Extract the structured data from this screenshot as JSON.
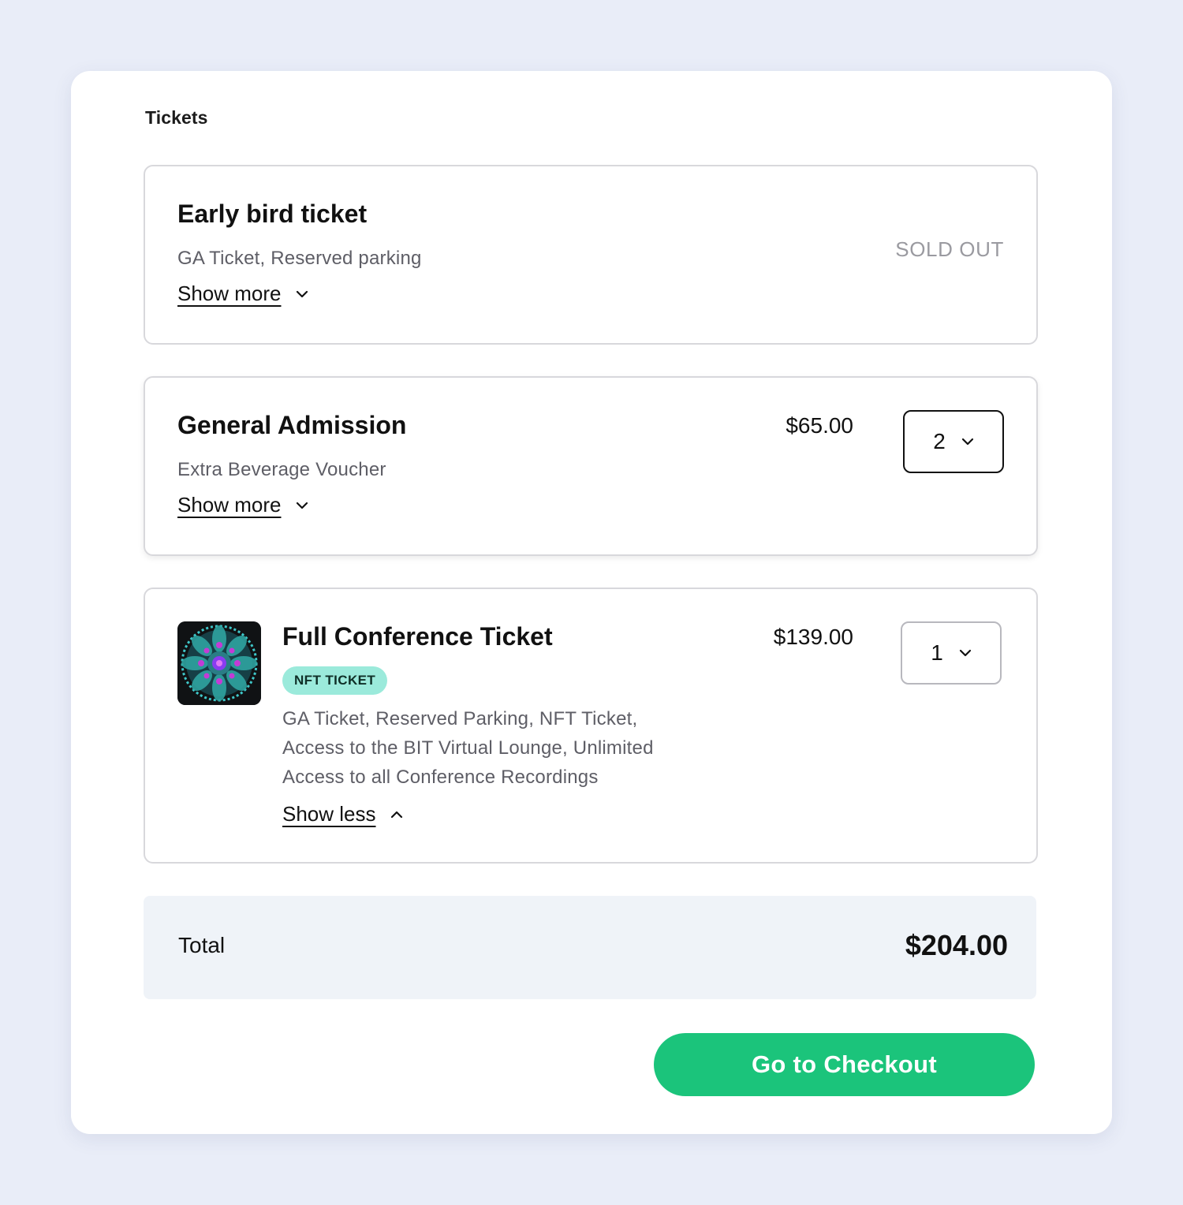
{
  "section_title": "Tickets",
  "tickets": [
    {
      "name": "Early bird ticket",
      "description": "GA Ticket, Reserved parking",
      "toggle_label": "Show more",
      "toggle_icon": "chevron-down-icon",
      "status": "SOLD OUT"
    },
    {
      "name": "General Admission",
      "description": "Extra Beverage Voucher",
      "toggle_label": "Show more",
      "toggle_icon": "chevron-down-icon",
      "price": "$65.00",
      "quantity": "2"
    },
    {
      "name": "Full Conference Ticket",
      "badge": "NFT TICKET",
      "description_lines": [
        "GA Ticket, Reserved Parking, NFT Ticket,",
        "Access to the BIT Virtual Lounge, Unlimited",
        "Access to all Conference Recordings"
      ],
      "toggle_label": "Show less",
      "toggle_icon": "chevron-up-icon",
      "price": "$139.00",
      "quantity": "1",
      "thumbnail": "kaleidoscope-nft-image"
    }
  ],
  "total": {
    "label": "Total",
    "value": "$204.00"
  },
  "checkout_button": "Go to Checkout",
  "colors": {
    "page_background": "#e9edf8",
    "card_background": "#ffffff",
    "accent_green": "#1bc47b",
    "badge_background": "#9beadb",
    "total_background": "#eff3f8"
  }
}
